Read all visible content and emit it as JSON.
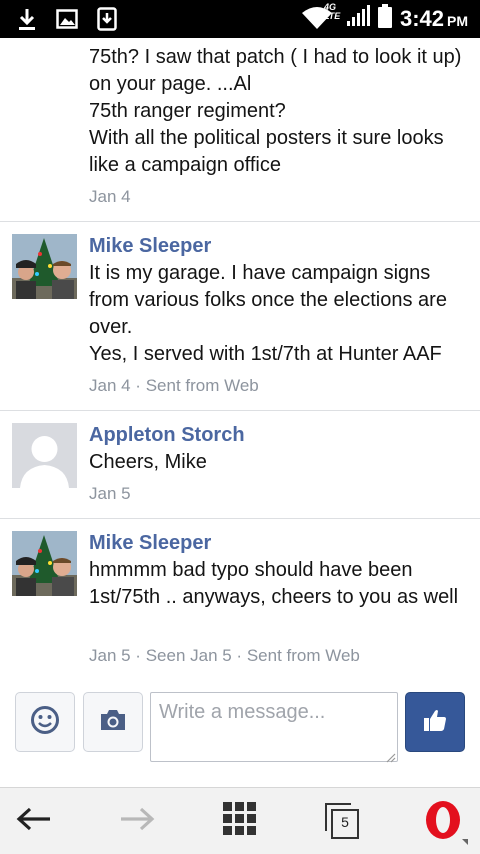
{
  "status_bar": {
    "network": "4G LTE",
    "time": "3:42",
    "ampm": "PM"
  },
  "messages": [
    {
      "lines": [
        "75th? I saw that patch ( I had to look it up) on your page. ...Al",
        "75th ranger regiment?",
        "With all the political posters it sure looks like a campaign office"
      ],
      "meta": "Jan 4"
    },
    {
      "sender": "Mike Sleeper",
      "lines": [
        "It is my garage. I have campaign signs from various folks once the elections are over.",
        "Yes, I served with 1st/7th at Hunter AAF"
      ],
      "meta": "Jan 4 · Sent from Web"
    },
    {
      "sender": "Appleton Storch",
      "lines": [
        "Cheers, Mike"
      ],
      "meta": "Jan 5"
    },
    {
      "sender": "Mike Sleeper",
      "lines": [
        "hmmmm bad typo should have been 1st/75th .. anyways, cheers to you as well"
      ],
      "meta": "Jan 5 · Seen Jan 5 · Sent from Web"
    }
  ],
  "composer": {
    "placeholder": "Write a message...",
    "emoji_icon": "smiley-icon",
    "camera_icon": "camera-icon",
    "like_icon": "thumbs-up-icon"
  },
  "browser_nav": {
    "tab_count": "5",
    "colors": {
      "opera": "#e3101e",
      "like": "#365899",
      "link": "#4b67a1"
    }
  }
}
